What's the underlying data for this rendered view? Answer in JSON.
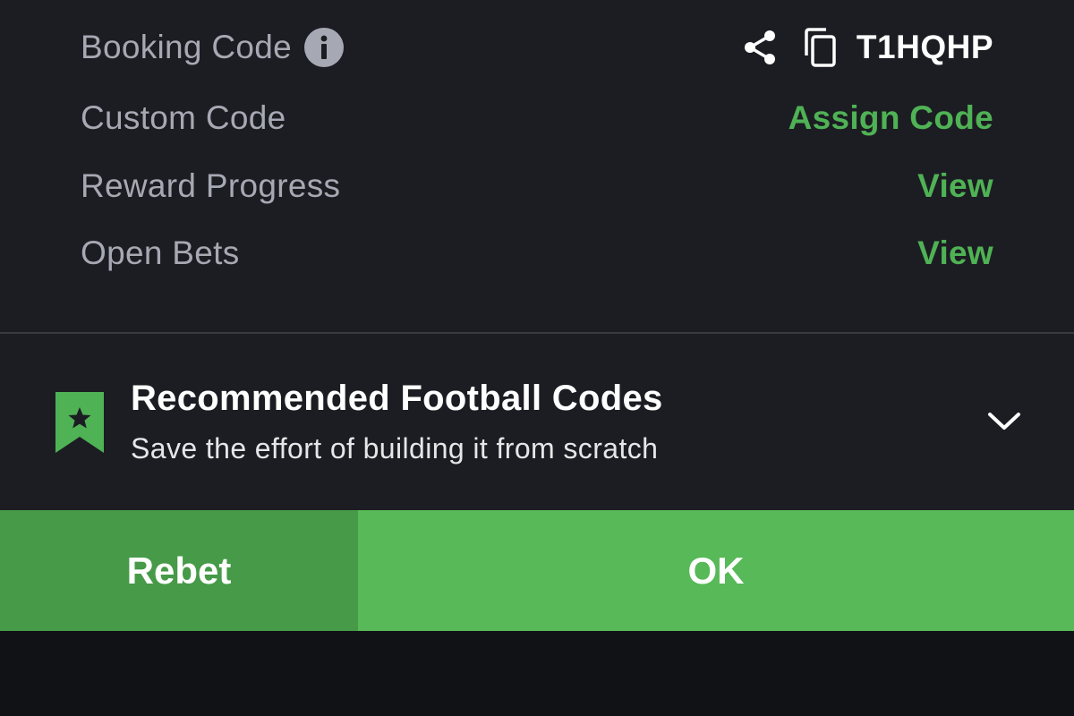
{
  "rows": {
    "booking_code": {
      "label": "Booking Code",
      "info_icon": "info-icon",
      "share_icon": "share-icon",
      "copy_icon": "copy-icon",
      "value": "T1HQHP"
    },
    "custom_code": {
      "label": "Custom Code",
      "action": "Assign Code"
    },
    "reward_progress": {
      "label": "Reward Progress",
      "action": "View"
    },
    "open_bets": {
      "label": "Open Bets",
      "action": "View"
    }
  },
  "recommended": {
    "icon": "bookmark-star-icon",
    "title": "Recommended Football Codes",
    "subtitle": "Save the effort of building it from scratch",
    "expand_icon": "chevron-down-icon"
  },
  "buttons": {
    "rebet": "Rebet",
    "ok": "OK"
  },
  "colors": {
    "accent_green": "#4fb255",
    "panel_bg": "#1c1d22",
    "rebet_bg": "#469a48",
    "ok_bg": "#57b957",
    "label_gray": "#a6a9b3"
  }
}
